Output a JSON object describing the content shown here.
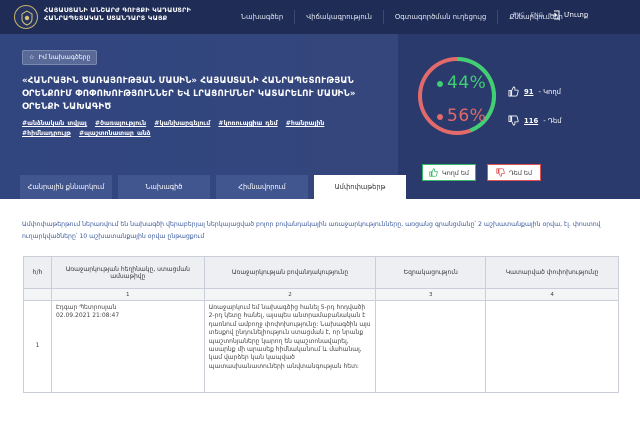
{
  "header": {
    "logo_line1": "ՀԱՅԱՍՏԱՆԻ ԱՆՇԱՐԺ ԳՈՒՅՔԻ ԿԱԴԱՍՏՐԻ",
    "logo_line2": "ՀԱՆՐԱՊԵՏԱԿԱՆ ՍՏԱՆԴԱՐՏ ԿԱՅՔ",
    "nav": [
      "Նախագծեր",
      "Վիճակագրություն",
      "Օգտագործման ուղեցույց",
      "Քննարկումներ"
    ],
    "lang": [
      "РУС",
      "ENG"
    ],
    "login": "Մուտք"
  },
  "hero": {
    "favorite": "Իմ նախագծերը",
    "title": "«ՀԱՆՐԱՅԻՆ ԾԱՌԱՅՈՒԹՅԱՆ ՄԱՍԻՆ» ՀԱՅԱՍՏԱՆԻ ՀԱՆՐԱՊԵՏՈՒԹՅԱՆ ՕՐԵՆՔՈՒՄ ՓՈՓՈԽՈՒԹՅՈՒՆՆԵՐ ԵՎ ԼՐԱՑՈՒՄՆԵՐ ԿԱՏԱՐԵԼՈՒ ՄԱՍԻՆ» ՕՐԵՆՔԻ ՆԱԽԱԳԻԾ",
    "tags": [
      "#անձնական_տվյալ",
      "#ծառայություն",
      "#կանխարգելում",
      "#կոռուպցիա_դեմ",
      "#հանրային",
      "#հիմնադրույթ",
      "#պաշտոնատար_անձ"
    ],
    "yes_pct": "44%",
    "no_pct": "56%",
    "yes_fraction": 0.44,
    "yes_count": "91",
    "yes_label": "- Կողմ",
    "no_count": "116",
    "no_label": "- Դեմ",
    "vote_yes": "Կողմ եմ",
    "vote_no": "Դեմ եմ",
    "colors": {
      "yes": "#3fcf74",
      "no": "#e36a6a"
    },
    "tabs": [
      "Հանրային քննարկում",
      "Նախագիծ",
      "Հիմնավորում",
      "Ամփոփաթերթ"
    ],
    "active_tab": 3
  },
  "content": {
    "description": "Ամփոփաթերթում ներառվում են նախագծի վերաբերյալ ներկայացված բոլոր բովանդակային առաջարկությունները, առցանց գրանցմանը՝ 2 աշխատանքային օրվա, էլ. փոստով ուղարկվածները՝ 10 աշխատանքային օրվա ընթացքում",
    "table": {
      "headers": [
        "հ/հ",
        "Առաջարկության հեղինակը, ստացման ամսաթիվը",
        "Առաջարկության բովանդակությունը",
        "Եզրակացություն",
        "Կատարված փոփոխությունը"
      ],
      "numbers": [
        "1",
        "2",
        "3",
        "4"
      ],
      "rows": [
        {
          "idx": "1",
          "author": "Էդգար Պետրոսյան",
          "date": "02.09.2021 21:08:47",
          "content": "Առաջարկում եմ նախագծից հանել 5-րդ հոդվածի 2-րդ կետը հանել, այսպես անտրամաբանական է դառնում ամբողջ փոփոխությունը: Նախագծին այս տեսքով ընդունելիություն ստացման է, որ նրանք պաշտոնյաները կարող են պաշտոնավարել, ասարնք մի արասեք հիմնականում և մահանալ, կամ վարձեր կան կապված պատասխանատուների անվտանգության հետ:",
          "conclusion": "",
          "change": ""
        }
      ]
    }
  }
}
